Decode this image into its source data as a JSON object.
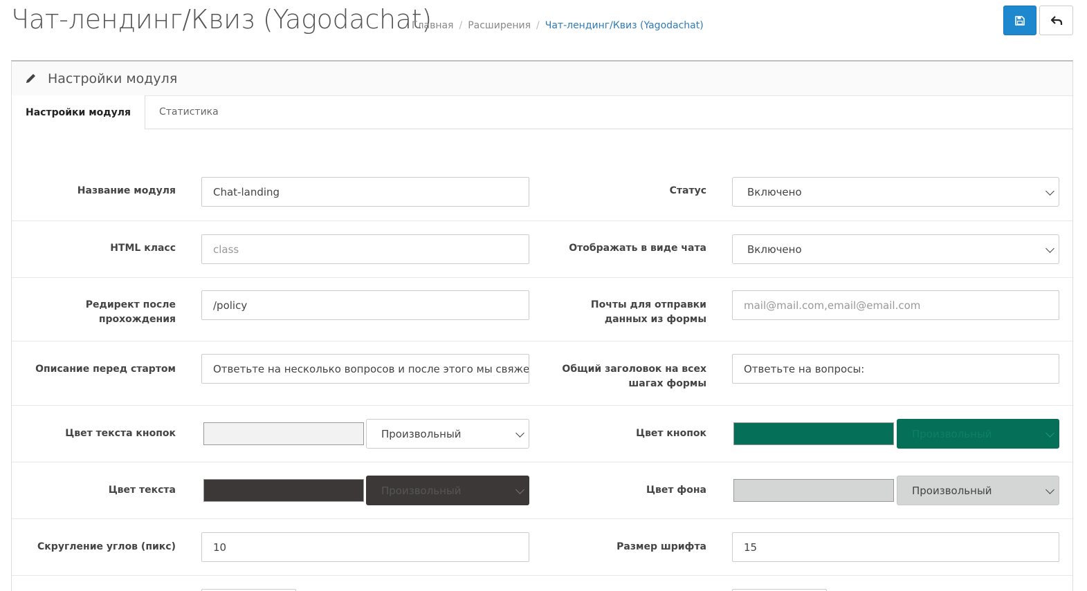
{
  "header": {
    "title": "Чат-лендинг/Квиз (Yagodachat)",
    "breadcrumbs": [
      "Главная",
      "Расширения",
      "Чат-лендинг/Квиз (Yagodachat)"
    ]
  },
  "panel": {
    "heading": "Настройки модуля",
    "tabs": [
      "Настройки модуля",
      "Статистика"
    ]
  },
  "form": {
    "module_name": {
      "label": "Название модуля",
      "value": "Chat-landing"
    },
    "status": {
      "label": "Статус",
      "value": "Включено"
    },
    "html_class": {
      "label": "HTML класс",
      "placeholder": "class"
    },
    "display_chat": {
      "label": "Отображать в виде чата",
      "value": "Включено"
    },
    "redirect": {
      "label": "Редирект после прохождения",
      "value": "/policy"
    },
    "emails": {
      "label": "Почты для отправки данных из формы",
      "placeholder": "mail@mail.com,email@email.com"
    },
    "description": {
      "label": "Описание перед стартом",
      "value": "Ответьте на несколько вопросов и после этого мы свяжемся"
    },
    "common_title": {
      "label": "Общий заголовок на всех шагах формы",
      "value": "Ответьте на вопросы:"
    },
    "button_text_color": {
      "label": "Цвет текста кнопок",
      "swatch": "#f2f2f2",
      "option": "Произвольный"
    },
    "button_color": {
      "label": "Цвет кнопок",
      "swatch": "#066f57",
      "option": "Произвольный"
    },
    "text_color": {
      "label": "Цвет текста",
      "swatch": "#3d3838",
      "option": "Произвольный"
    },
    "bg_color": {
      "label": "Цвет фона",
      "swatch": "#d3d6d5",
      "option": "Произвольный"
    },
    "border_radius": {
      "label": "Скругление углов (пикс)",
      "value": "10"
    },
    "font_size": {
      "label": "Размер шрифта",
      "value": "15"
    }
  },
  "colors": {
    "primary": "#1e88cf",
    "link": "#2e7bb9"
  }
}
